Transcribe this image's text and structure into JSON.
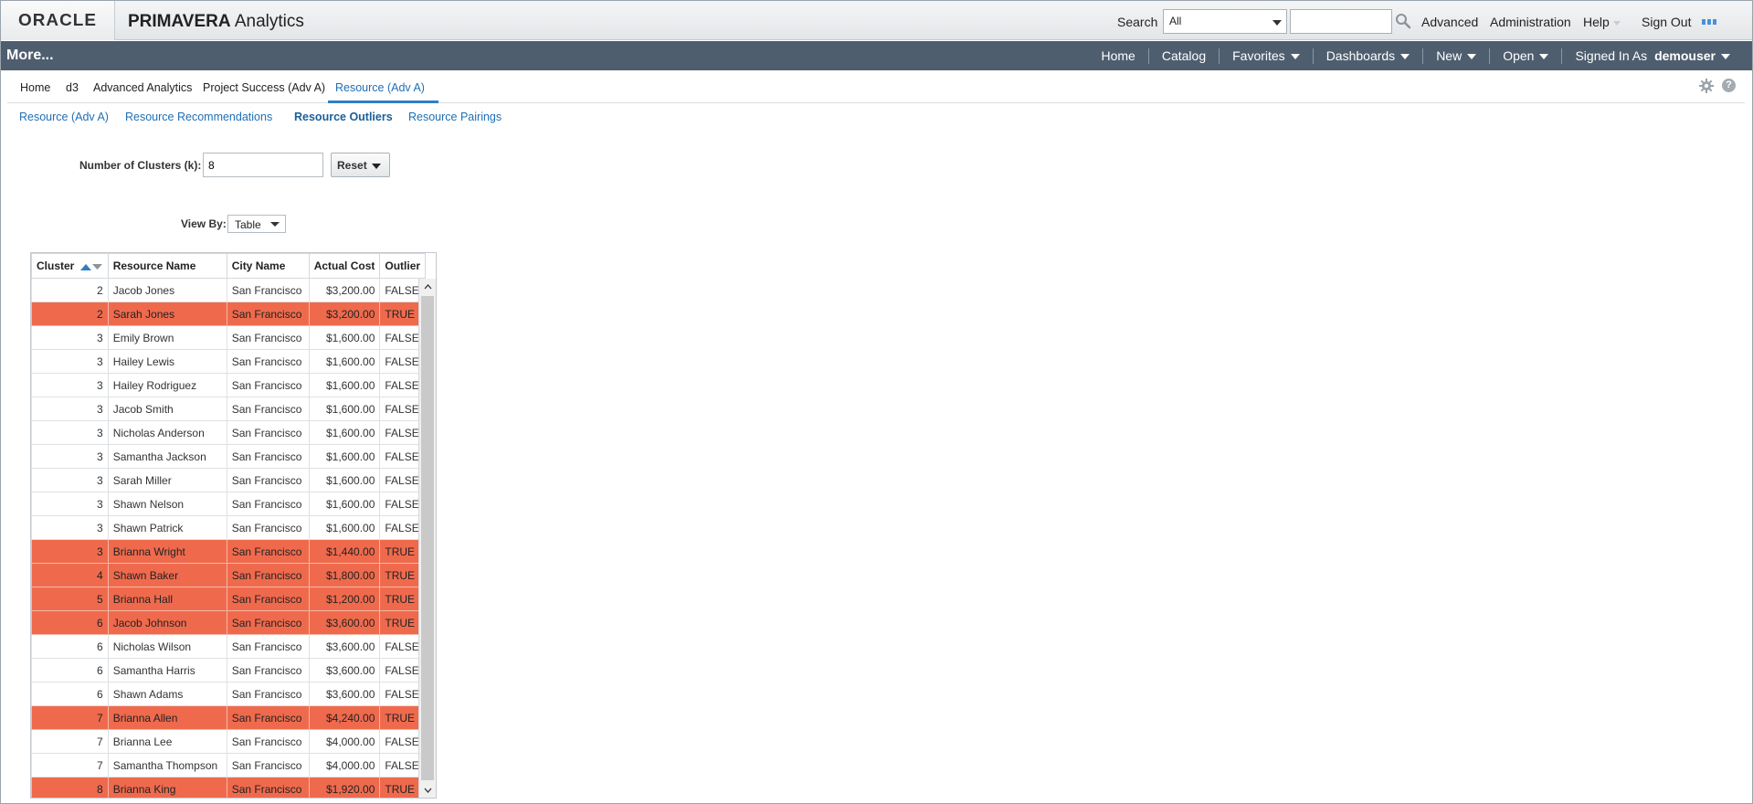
{
  "header": {
    "brand": "ORACLE",
    "app_title_bold": "PRIMAVERA",
    "app_title_rest": "Analytics",
    "search_label": "Search",
    "search_scope": "All",
    "search_value": "",
    "links": [
      "Advanced",
      "Administration",
      "Help",
      "Sign Out"
    ]
  },
  "navbar": {
    "more": "More...",
    "items": [
      "Home",
      "Catalog",
      "Favorites",
      "Dashboards",
      "New",
      "Open"
    ],
    "signed_in_label": "Signed In As",
    "user": "demouser"
  },
  "dashboard_tabs": [
    "Home",
    "d3",
    "Advanced Analytics",
    "Project Success (Adv A)",
    "Resource (Adv A)"
  ],
  "active_tab": "Resource (Adv A)",
  "page_links": [
    "Resource (Adv A)",
    "Resource Recommendations",
    "Resource Outliers",
    "Resource Pairings"
  ],
  "active_page": "Resource Outliers",
  "prompts": {
    "clusters_label": "Number of Clusters (k):",
    "clusters_value": "8",
    "reset_label": "Reset",
    "viewby_label": "View By:",
    "viewby_value": "Table"
  },
  "table": {
    "columns": [
      "Cluster",
      "Resource Name",
      "City Name",
      "Actual Cost",
      "Outlier"
    ],
    "rows": [
      [
        "2",
        "Jacob Jones",
        "San Francisco",
        "$3,200.00",
        "FALSE"
      ],
      [
        "2",
        "Sarah Jones",
        "San Francisco",
        "$3,200.00",
        "TRUE"
      ],
      [
        "3",
        "Emily Brown",
        "San Francisco",
        "$1,600.00",
        "FALSE"
      ],
      [
        "3",
        "Hailey Lewis",
        "San Francisco",
        "$1,600.00",
        "FALSE"
      ],
      [
        "3",
        "Hailey Rodriguez",
        "San Francisco",
        "$1,600.00",
        "FALSE"
      ],
      [
        "3",
        "Jacob Smith",
        "San Francisco",
        "$1,600.00",
        "FALSE"
      ],
      [
        "3",
        "Nicholas Anderson",
        "San Francisco",
        "$1,600.00",
        "FALSE"
      ],
      [
        "3",
        "Samantha Jackson",
        "San Francisco",
        "$1,600.00",
        "FALSE"
      ],
      [
        "3",
        "Sarah Miller",
        "San Francisco",
        "$1,600.00",
        "FALSE"
      ],
      [
        "3",
        "Shawn Nelson",
        "San Francisco",
        "$1,600.00",
        "FALSE"
      ],
      [
        "3",
        "Shawn Patrick",
        "San Francisco",
        "$1,600.00",
        "FALSE"
      ],
      [
        "3",
        "Brianna Wright",
        "San Francisco",
        "$1,440.00",
        "TRUE"
      ],
      [
        "4",
        "Shawn Baker",
        "San Francisco",
        "$1,800.00",
        "TRUE"
      ],
      [
        "5",
        "Brianna Hall",
        "San Francisco",
        "$1,200.00",
        "TRUE"
      ],
      [
        "6",
        "Jacob Johnson",
        "San Francisco",
        "$3,600.00",
        "TRUE"
      ],
      [
        "6",
        "Nicholas Wilson",
        "San Francisco",
        "$3,600.00",
        "FALSE"
      ],
      [
        "6",
        "Samantha Harris",
        "San Francisco",
        "$3,600.00",
        "FALSE"
      ],
      [
        "6",
        "Shawn Adams",
        "San Francisco",
        "$3,600.00",
        "FALSE"
      ],
      [
        "7",
        "Brianna Allen",
        "San Francisco",
        "$4,240.00",
        "TRUE"
      ],
      [
        "7",
        "Brianna Lee",
        "San Francisco",
        "$4,000.00",
        "FALSE"
      ],
      [
        "7",
        "Samantha Thompson",
        "San Francisco",
        "$4,000.00",
        "FALSE"
      ],
      [
        "8",
        "Brianna King",
        "San Francisco",
        "$1,920.00",
        "TRUE"
      ]
    ]
  },
  "colors": {
    "outlier_row": "#ef6a4d",
    "nav_bg": "#4e5e6f",
    "link": "#1f6fb5"
  },
  "icons": {
    "search": "search-icon",
    "gear": "gear-icon",
    "help": "help-icon",
    "sort": "sort-asc-desc-icon"
  }
}
